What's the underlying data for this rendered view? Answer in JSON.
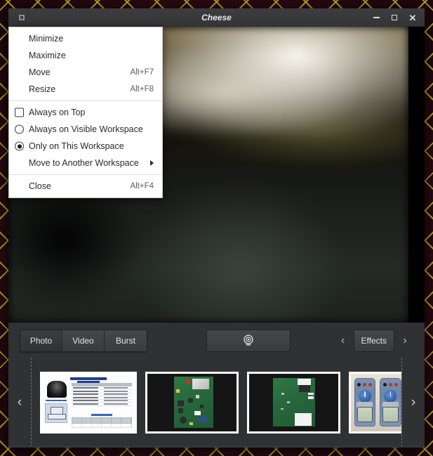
{
  "desktop": {
    "wallpaper_base_color": "#2a0d12",
    "wallpaper_accent_color": "#c8af2d"
  },
  "window": {
    "title": "Cheese",
    "icon": "window-menu-icon",
    "controls": {
      "minimize_label": "–",
      "maximize_label": "□",
      "close_label": "✕"
    }
  },
  "window_menu": {
    "items": [
      {
        "label": "Minimize",
        "accel": "",
        "mark": "none",
        "checked": false,
        "submenu": false
      },
      {
        "label": "Maximize",
        "accel": "",
        "mark": "none",
        "checked": false,
        "submenu": false
      },
      {
        "label": "Move",
        "accel": "Alt+F7",
        "mark": "none",
        "checked": false,
        "submenu": false
      },
      {
        "label": "Resize",
        "accel": "Alt+F8",
        "mark": "none",
        "checked": false,
        "submenu": false
      },
      {
        "label": "Always on Top",
        "accel": "",
        "mark": "checkbox",
        "checked": false,
        "submenu": false
      },
      {
        "label": "Always on Visible Workspace",
        "accel": "",
        "mark": "radio",
        "checked": false,
        "submenu": false
      },
      {
        "label": "Only on This Workspace",
        "accel": "",
        "mark": "radio",
        "checked": true,
        "submenu": false
      },
      {
        "label": "Move to Another Workspace",
        "accel": "",
        "mark": "none",
        "checked": false,
        "submenu": true
      },
      {
        "label": "Close",
        "accel": "Alt+F4",
        "mark": "none",
        "checked": false,
        "submenu": false
      }
    ],
    "separator_after_indices": [
      3,
      7
    ]
  },
  "preview": {
    "description": "live webcam preview, blurred dark scene"
  },
  "toolbar": {
    "modes": [
      {
        "label": "Photo",
        "active": true
      },
      {
        "label": "Video",
        "active": false
      },
      {
        "label": "Burst",
        "active": false
      }
    ],
    "capture_icon": "webcam-icon",
    "effects": {
      "prev_label": "‹",
      "label": "Effects",
      "next_label": "›"
    }
  },
  "thumbnails": {
    "prev_label": "‹",
    "next_label": "›",
    "items": [
      {
        "kind": "document",
        "caption": "product datasheet page"
      },
      {
        "kind": "pcb-green",
        "caption": "green circuit board on dark mat"
      },
      {
        "kind": "pcb-green2",
        "caption": "green circuit board reverse side"
      },
      {
        "kind": "multimeter",
        "caption": "three handheld multimeters"
      }
    ]
  }
}
